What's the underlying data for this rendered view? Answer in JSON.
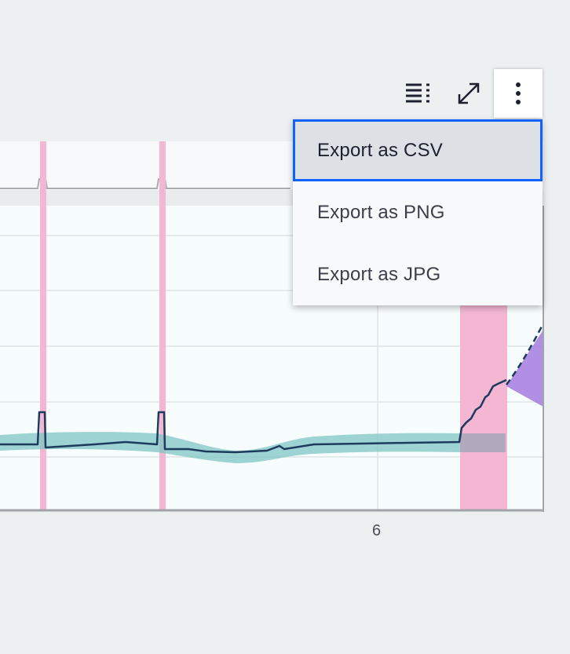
{
  "toolbar": {
    "legend_icon": "legend-icon",
    "fullscreen_icon": "expand-icon",
    "overflow_icon": "overflow-menu-vertical-icon"
  },
  "menu": {
    "items": [
      {
        "label": "Export as CSV"
      },
      {
        "label": "Export as PNG"
      },
      {
        "label": "Export as JPG"
      }
    ]
  },
  "chart": {
    "x_tick_label": "6"
  },
  "colors": {
    "line": "#1d3b5c",
    "band": "#7fc6c3",
    "highlight": "#f3b6d3",
    "forecast": "#a57be0",
    "focus": "#0f62fe"
  }
}
